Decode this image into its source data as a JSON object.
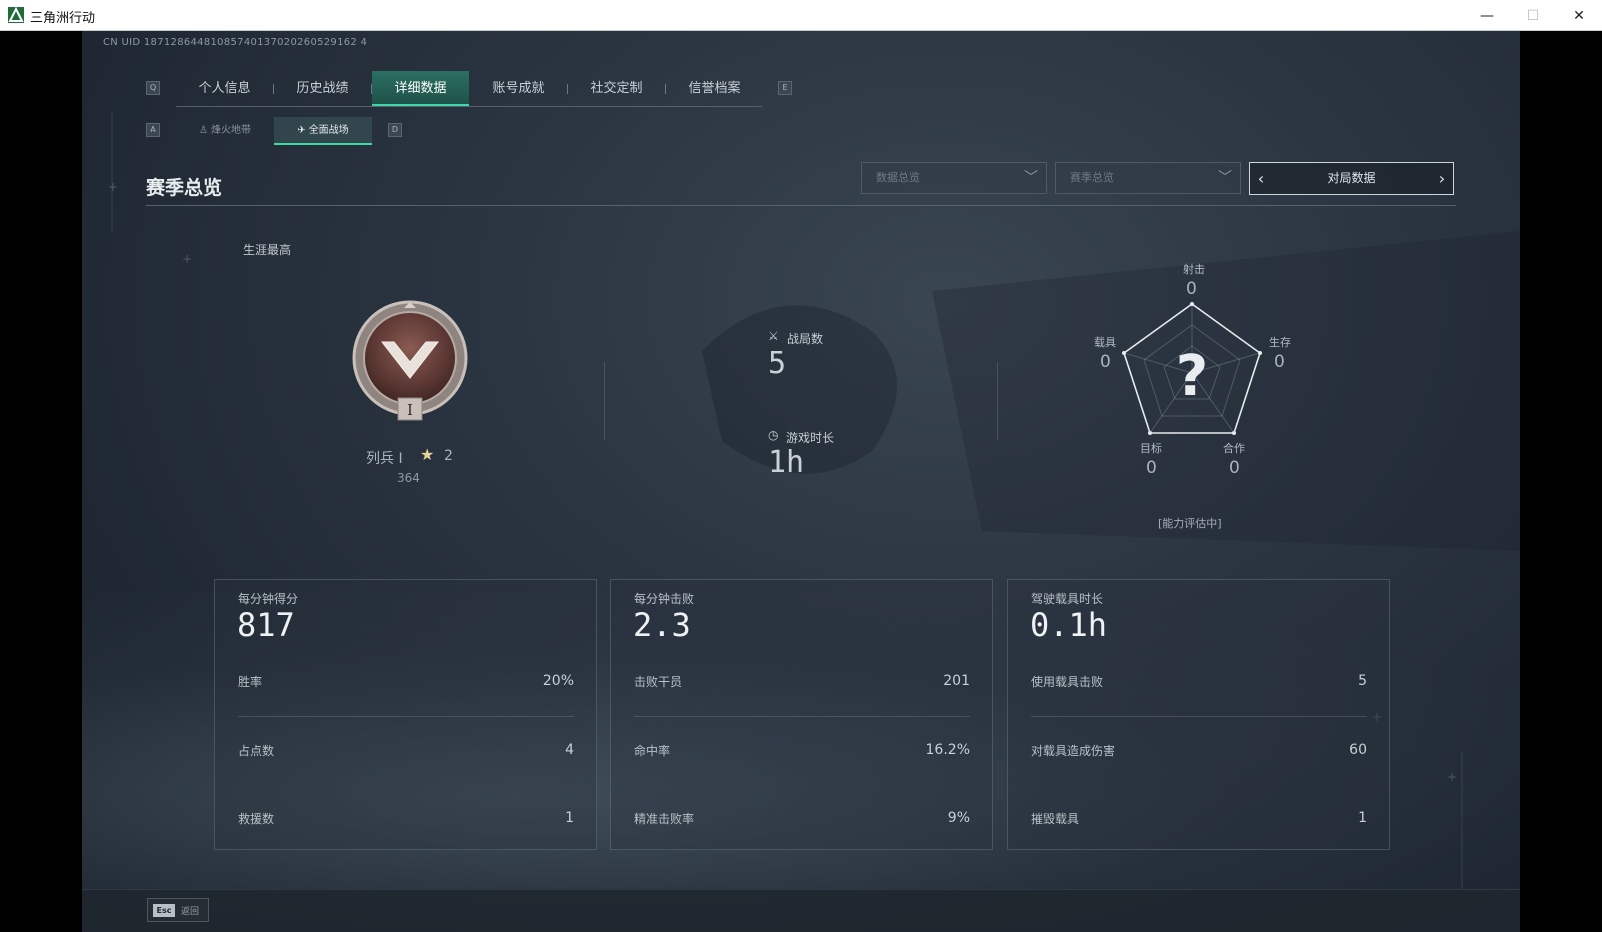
{
  "window": {
    "title": "三角洲行动",
    "controls": {
      "minimize": "—",
      "maximize": "☐",
      "close": "✕"
    }
  },
  "uid_text": "CN UID 18712864481085740137020260529162 4",
  "nav": {
    "key_left": "Q",
    "key_right": "E",
    "tabs": [
      {
        "label": "个人信息"
      },
      {
        "label": "历史战绩"
      },
      {
        "label": "详细数据",
        "active": true
      },
      {
        "label": "账号成就"
      },
      {
        "label": "社交定制"
      },
      {
        "label": "信誉档案"
      }
    ]
  },
  "subnav": {
    "key_left": "A",
    "key_right": "D",
    "tabs": [
      {
        "label": "烽火地带",
        "icon": "tower-icon"
      },
      {
        "label": "全面战场",
        "icon": "wing-icon",
        "active": true
      }
    ]
  },
  "section": {
    "title": "赛季总览"
  },
  "filters": {
    "dropdown1": "数据总览",
    "dropdown2": "赛季总览",
    "pager_label": "对局数据"
  },
  "career": {
    "label": "生涯最高",
    "rank_name": "列兵 I",
    "stars": "2",
    "points": "364"
  },
  "stats": {
    "matches_label": "战局数",
    "matches_value": "5",
    "playtime_label": "游戏时长",
    "playtime_value": "1h"
  },
  "radar": {
    "center": "?",
    "axes": [
      {
        "label": "射击",
        "value": "0"
      },
      {
        "label": "生存",
        "value": "0"
      },
      {
        "label": "合作",
        "value": "0"
      },
      {
        "label": "目标",
        "value": "0"
      },
      {
        "label": "载具",
        "value": "0"
      }
    ],
    "note": "[能力评估中]"
  },
  "cards": [
    {
      "title": "每分钟得分",
      "value": "817",
      "rows": [
        {
          "label": "胜率",
          "value": "20%"
        },
        {
          "label": "占点数",
          "value": "4"
        },
        {
          "label": "救援数",
          "value": "1"
        }
      ]
    },
    {
      "title": "每分钟击败",
      "value": "2.3",
      "rows": [
        {
          "label": "击败干员",
          "value": "201"
        },
        {
          "label": "命中率",
          "value": "16.2%"
        },
        {
          "label": "精准击败率",
          "value": "9%"
        }
      ]
    },
    {
      "title": "驾驶载具时长",
      "value": "0.1h",
      "rows": [
        {
          "label": "使用载具击败",
          "value": "5"
        },
        {
          "label": "对载具造成伤害",
          "value": "60"
        },
        {
          "label": "摧毁载具",
          "value": "1"
        }
      ]
    }
  ],
  "footer": {
    "esc_key": "Esc",
    "back_label": "返回"
  }
}
